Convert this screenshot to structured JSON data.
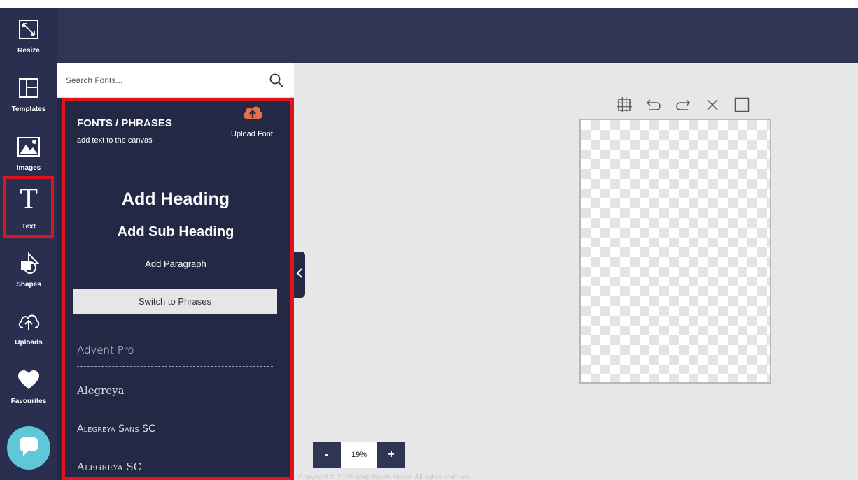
{
  "sidebar": {
    "items": [
      {
        "label": "Resize",
        "icon": "resize-icon"
      },
      {
        "label": "Templates",
        "icon": "templates-icon"
      },
      {
        "label": "Images",
        "icon": "image-icon"
      },
      {
        "label": "Text",
        "icon": "text-icon",
        "active": true
      },
      {
        "label": "Shapes",
        "icon": "shapes-icon"
      },
      {
        "label": "Uploads",
        "icon": "cloud-upload-icon"
      },
      {
        "label": "Favourites",
        "icon": "heart-icon"
      }
    ],
    "chat_icon": "chat-bubble-icon"
  },
  "search": {
    "placeholder": "Search Fonts...",
    "value": ""
  },
  "panel": {
    "title": "FONTS / PHRASES",
    "subtitle": "add text to the canvas",
    "upload_font_label": "Upload Font",
    "add_heading": "Add Heading",
    "add_sub_heading": "Add Sub Heading",
    "add_paragraph": "Add Paragraph",
    "switch_label": "Switch to Phrases",
    "fonts": [
      "Advent Pro",
      "Alegreya",
      "Alegreya Sans SC",
      "Alegreya SC"
    ]
  },
  "canvas_toolbar": {
    "icons": [
      "grid-icon",
      "undo-icon",
      "redo-icon",
      "close-icon",
      "square-icon"
    ]
  },
  "zoom": {
    "minus": "-",
    "value": "19%",
    "plus": "+"
  },
  "footer": {
    "copyright": "Copyright © 2020 Wagnbrush Media. All rights reserved."
  },
  "colors": {
    "accent": "#e0141e",
    "sidebar": "#2a2f4f",
    "panel": "#232945",
    "upload": "#ef6c49",
    "chat": "#5ec8d8"
  }
}
